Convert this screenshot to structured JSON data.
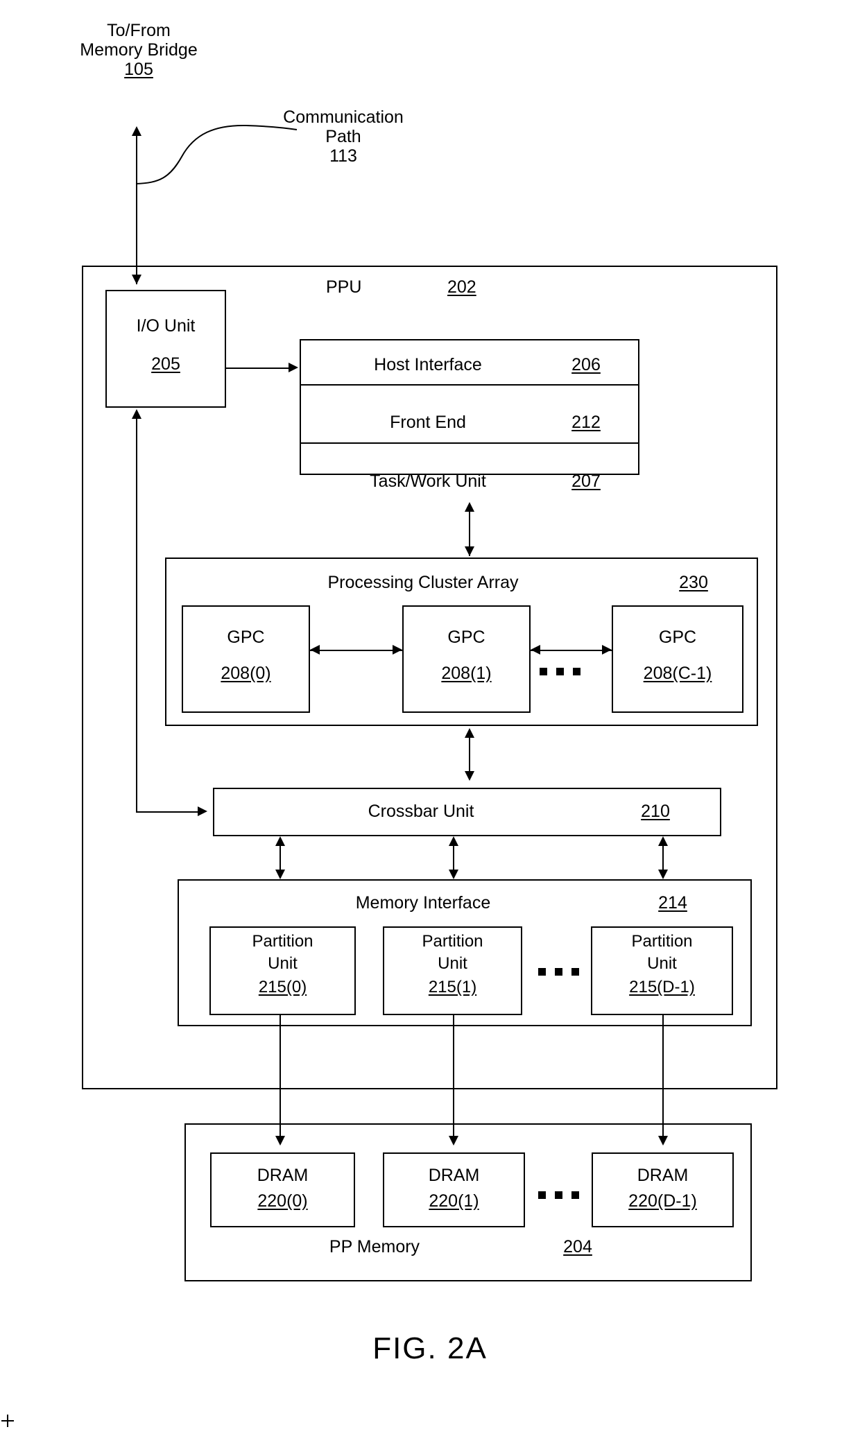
{
  "figure": {
    "caption": "FIG. 2A"
  },
  "callouts": {
    "memory_bridge": {
      "line1": "To/From",
      "line2": "Memory Bridge",
      "ref": "105"
    },
    "communication_path": {
      "line1": "Communication",
      "line2": "Path",
      "ref": "113"
    }
  },
  "ppu": {
    "label": "PPU",
    "ref": "202"
  },
  "io_unit": {
    "label": "I/O Unit",
    "ref": "205"
  },
  "front_stack": {
    "rows": [
      {
        "label": "Host Interface",
        "ref": "206"
      },
      {
        "label": "Front End",
        "ref": "212"
      },
      {
        "label": "Task/Work Unit",
        "ref": "207"
      }
    ]
  },
  "processing_cluster_array": {
    "label": "Processing Cluster Array",
    "ref": "230",
    "gpcs": [
      {
        "label": "GPC",
        "ref": "208(0)"
      },
      {
        "label": "GPC",
        "ref": "208(1)"
      },
      {
        "label": "GPC",
        "ref": "208(C-1)"
      }
    ],
    "ellipsis": "• • •"
  },
  "crossbar_unit": {
    "label": "Crossbar Unit",
    "ref": "210"
  },
  "memory_interface": {
    "label": "Memory Interface",
    "ref": "214",
    "partitions": [
      {
        "line1": "Partition",
        "line2": "Unit",
        "ref": "215(0)"
      },
      {
        "line1": "Partition",
        "line2": "Unit",
        "ref": "215(1)"
      },
      {
        "line1": "Partition",
        "line2": "Unit",
        "ref": "215(D-1)"
      }
    ],
    "ellipsis": "• • •"
  },
  "pp_memory": {
    "label": "PP Memory",
    "ref": "204",
    "drams": [
      {
        "label": "DRAM",
        "ref": "220(0)"
      },
      {
        "label": "DRAM",
        "ref": "220(1)"
      },
      {
        "label": "DRAM",
        "ref": "220(D-1)"
      }
    ],
    "ellipsis": "• • •"
  },
  "colors": {
    "ink": "#000000",
    "paper": "#ffffff"
  }
}
